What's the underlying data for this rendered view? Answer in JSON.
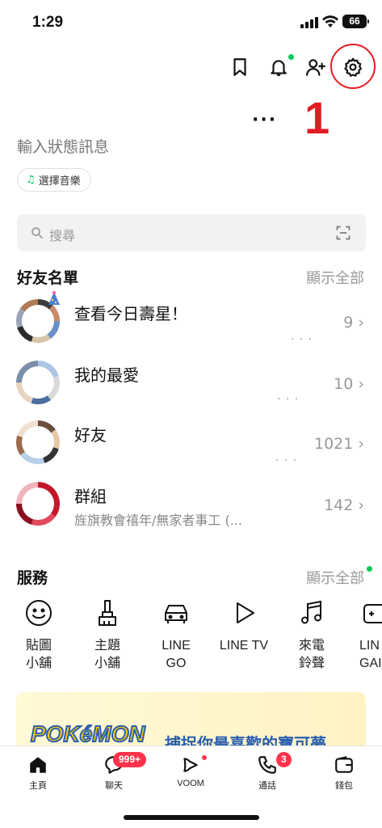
{
  "status_bar": {
    "time": "1:29",
    "battery": "66"
  },
  "header": {
    "icons": [
      "bookmark-icon",
      "bell-icon",
      "add-friend-icon",
      "gear-icon"
    ],
    "annotation_number": "1",
    "annotation_color": "#e31c23",
    "more": "···"
  },
  "profile": {
    "status_message": "輸入狀態訊息",
    "music_label": "選擇音樂"
  },
  "search": {
    "placeholder": "搜尋"
  },
  "friends": {
    "title": "好友名單",
    "show_all": "顯示全部",
    "rows": [
      {
        "name": "查看今日壽星！",
        "count": "9 ›",
        "sub": ""
      },
      {
        "name": "我的最愛",
        "count": "10 ›",
        "sub": ""
      },
      {
        "name": "好友",
        "count": "1021 ›",
        "sub": ""
      },
      {
        "name": "群組",
        "count": "142 ›",
        "sub": "旌旗教會禧年/無家者事工 (..."
      }
    ]
  },
  "services": {
    "title": "服務",
    "show_all": "顯示全部",
    "items": [
      {
        "label": "貼圖\n小舖",
        "icon": "smiley-icon"
      },
      {
        "label": "主題\n小舖",
        "icon": "brush-icon"
      },
      {
        "label": "LINE\nGO",
        "icon": "car-icon"
      },
      {
        "label": "LINE TV",
        "icon": "play-icon"
      },
      {
        "label": "來電\n鈴聲",
        "icon": "music-note-icon"
      },
      {
        "label": "LIN\nGAI",
        "icon": "game-icon"
      }
    ]
  },
  "banner": {
    "brand": "POKéMON",
    "slogan": "捕捉你最喜歡的寶可夢"
  },
  "tabs": [
    {
      "label": "主頁",
      "icon": "home-icon"
    },
    {
      "label": "聊天",
      "icon": "chat-icon",
      "badge": "999+"
    },
    {
      "label": "VOOM",
      "icon": "voom-icon"
    },
    {
      "label": "通話",
      "icon": "phone-icon",
      "badge": "3"
    },
    {
      "label": "錢包",
      "icon": "wallet-icon"
    }
  ],
  "colors": {
    "line_green": "#06c755",
    "badge_red": "#ff334b"
  }
}
